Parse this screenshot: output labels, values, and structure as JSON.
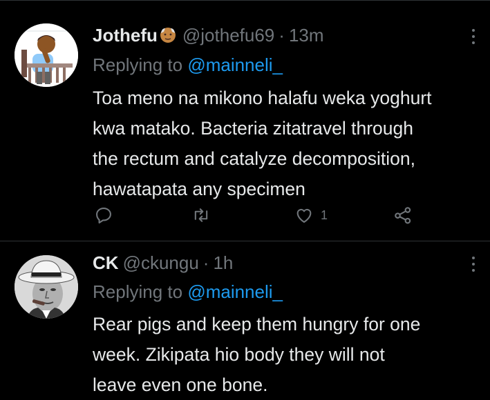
{
  "tweets": [
    {
      "display_name": "Jothefu",
      "name_emoji": "older-man-emoji",
      "handle": "@jothefu69",
      "separator": "·",
      "time": "13m",
      "reply_prefix": "Replying to",
      "reply_to": "@mainneli_",
      "body_lines": [
        "Toa meno na mikono halafu weka yoghurt",
        "kwa matako. Bacteria zitatravel through",
        "the rectum and catalyze decomposition,",
        "hawatapata any specimen"
      ],
      "like_count": "1",
      "avatar": "cartoon-man-at-desk-avatar"
    },
    {
      "display_name": "CK",
      "handle": "@ckungu",
      "separator": "·",
      "time": "1h",
      "reply_prefix": "Replying to",
      "reply_to": "@mainneli_",
      "body_lines": [
        "Rear pigs and keep them hungry for one",
        "week. Zikipata hio body they will not",
        "leave even one bone."
      ],
      "avatar": "man-in-fedora-with-cigar-avatar"
    }
  ],
  "colors": {
    "background": "#000000",
    "text": "#e7e9ea",
    "secondary": "#71767b",
    "link": "#1d9bf0",
    "divider": "#2f3336"
  }
}
